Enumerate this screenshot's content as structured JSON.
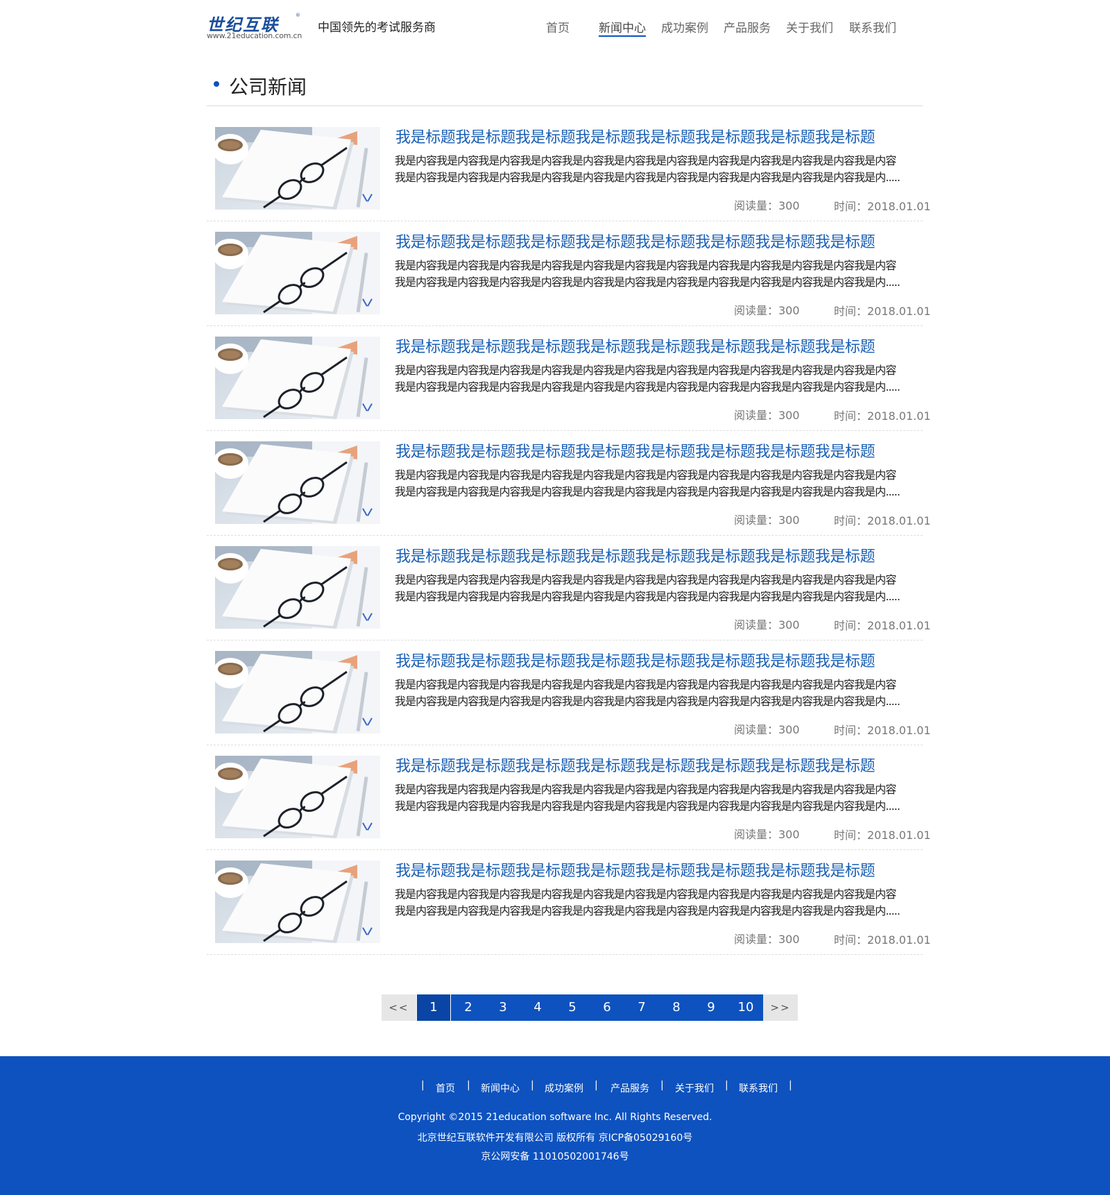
{
  "header": {
    "logo_text": "世纪互联",
    "logo_mark": "®",
    "logo_url": "www.21education.com.cn",
    "slogan": "中国领先的考试服务商",
    "nav": [
      "首页",
      "新闻中心",
      "成功案例",
      "产品服务",
      "关于我们",
      "联系我们"
    ],
    "active_nav": "新闻中心"
  },
  "section": {
    "title": "公司新闻"
  },
  "news": [
    {
      "title": "我是标题我是标题我是标题我是标题我是标题我是标题我是标题我是标题",
      "line1": "我是内容我是内容我是内容我是内容我是内容我是内容我是内容我是内容我是内容我是内容我是内容我是内容",
      "line2": "我是内容我是内容我是内容我是内容我是内容我是内容我是内容我是内容我是内容我是内容我是内容我是内.....",
      "reads": "阅读量：300",
      "date": "时间：2018.01.01"
    },
    {
      "title": "我是标题我是标题我是标题我是标题我是标题我是标题我是标题我是标题",
      "line1": "我是内容我是内容我是内容我是内容我是内容我是内容我是内容我是内容我是内容我是内容我是内容我是内容",
      "line2": "我是内容我是内容我是内容我是内容我是内容我是内容我是内容我是内容我是内容我是内容我是内容我是内.....",
      "reads": "阅读量：300",
      "date": "时间：2018.01.01"
    },
    {
      "title": "我是标题我是标题我是标题我是标题我是标题我是标题我是标题我是标题",
      "line1": "我是内容我是内容我是内容我是内容我是内容我是内容我是内容我是内容我是内容我是内容我是内容我是内容",
      "line2": "我是内容我是内容我是内容我是内容我是内容我是内容我是内容我是内容我是内容我是内容我是内容我是内.....",
      "reads": "阅读量：300",
      "date": "时间：2018.01.01"
    },
    {
      "title": "我是标题我是标题我是标题我是标题我是标题我是标题我是标题我是标题",
      "line1": "我是内容我是内容我是内容我是内容我是内容我是内容我是内容我是内容我是内容我是内容我是内容我是内容",
      "line2": "我是内容我是内容我是内容我是内容我是内容我是内容我是内容我是内容我是内容我是内容我是内容我是内.....",
      "reads": "阅读量：300",
      "date": "时间：2018.01.01"
    },
    {
      "title": "我是标题我是标题我是标题我是标题我是标题我是标题我是标题我是标题",
      "line1": "我是内容我是内容我是内容我是内容我是内容我是内容我是内容我是内容我是内容我是内容我是内容我是内容",
      "line2": "我是内容我是内容我是内容我是内容我是内容我是内容我是内容我是内容我是内容我是内容我是内容我是内.....",
      "reads": "阅读量：300",
      "date": "时间：2018.01.01"
    },
    {
      "title": "我是标题我是标题我是标题我是标题我是标题我是标题我是标题我是标题",
      "line1": "我是内容我是内容我是内容我是内容我是内容我是内容我是内容我是内容我是内容我是内容我是内容我是内容",
      "line2": "我是内容我是内容我是内容我是内容我是内容我是内容我是内容我是内容我是内容我是内容我是内容我是内.....",
      "reads": "阅读量：300",
      "date": "时间：2018.01.01"
    },
    {
      "title": "我是标题我是标题我是标题我是标题我是标题我是标题我是标题我是标题",
      "line1": "我是内容我是内容我是内容我是内容我是内容我是内容我是内容我是内容我是内容我是内容我是内容我是内容",
      "line2": "我是内容我是内容我是内容我是内容我是内容我是内容我是内容我是内容我是内容我是内容我是内容我是内.....",
      "reads": "阅读量：300",
      "date": "时间：2018.01.01"
    },
    {
      "title": "我是标题我是标题我是标题我是标题我是标题我是标题我是标题我是标题",
      "line1": "我是内容我是内容我是内容我是内容我是内容我是内容我是内容我是内容我是内容我是内容我是内容我是内容",
      "line2": "我是内容我是内容我是内容我是内容我是内容我是内容我是内容我是内容我是内容我是内容我是内容我是内.....",
      "reads": "阅读量：300",
      "date": "时间：2018.01.01"
    }
  ],
  "pagination": {
    "prev": "<<",
    "next": ">>",
    "pages": [
      "1",
      "2",
      "3",
      "4",
      "5",
      "6",
      "7",
      "8",
      "9",
      "10"
    ],
    "current": "1"
  },
  "footer": {
    "nav": [
      "首页",
      "新闻中心",
      "成功案例",
      "产品服务",
      "关于我们",
      "联系我们"
    ],
    "separator": "|",
    "copyright": "Copyright ©2015 21education software Inc. All Rights Reserved.",
    "company": "北京世纪互联软件开发有限公司 版权所有 京ICP备05029160号",
    "police": "京公网安备 11010502001746号"
  },
  "colors": {
    "brand_blue": "#0d52bf",
    "title_blue": "#1a5fb4",
    "pager_gray": "#e6e6e6"
  },
  "icons": {
    "thumbnail": "notebook-glasses-photo"
  }
}
